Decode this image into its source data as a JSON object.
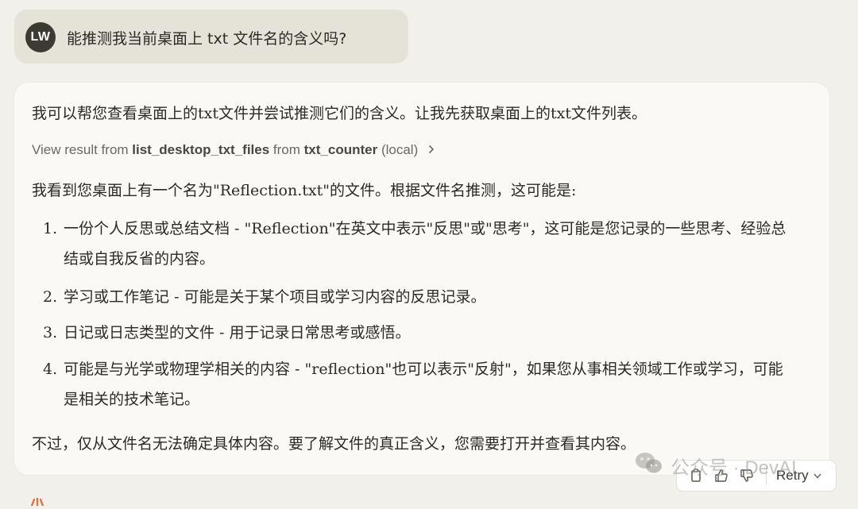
{
  "user": {
    "avatar_initials": "LW",
    "message": "能推测我当前桌面上 txt 文件名的含义吗?"
  },
  "assistant": {
    "intro": "我可以帮您查看桌面上的txt文件并尝试推测它们的含义。让我先获取桌面上的txt文件列表。",
    "tool_prefix": "View result from ",
    "tool_name": "list_desktop_txt_files",
    "tool_mid": " from ",
    "tool_server": "txt_counter",
    "tool_suffix": " (local)",
    "finding": "我看到您桌面上有一个名为\"Reflection.txt\"的文件。根据文件名推测，这可能是:",
    "list": [
      {
        "num": "1.",
        "text": "一份个人反思或总结文档 - \"Reflection\"在英文中表示\"反思\"或\"思考\"，这可能是您记录的一些思考、经验总结或自我反省的内容。"
      },
      {
        "num": "2.",
        "text": "学习或工作笔记 - 可能是关于某个项目或学习内容的反思记录。"
      },
      {
        "num": "3.",
        "text": "日记或日志类型的文件 - 用于记录日常思考或感悟。"
      },
      {
        "num": "4.",
        "text": "可能是与光学或物理学相关的内容 - \"reflection\"也可以表示\"反射\"，如果您从事相关领域工作或学习，可能是相关的技术笔记。"
      }
    ],
    "conclusion": "不过，仅从文件名无法确定具体内容。要了解文件的真正含义，您需要打开并查看其内容。"
  },
  "actions": {
    "retry_label": "Retry"
  },
  "watermark": {
    "text": "公众号 · DevAI"
  },
  "colors": {
    "page_bg": "#f2f0ea",
    "user_bubble": "#e5e2d8",
    "card_bg": "#faf9f5",
    "avatar_bg": "#3d3a33"
  }
}
